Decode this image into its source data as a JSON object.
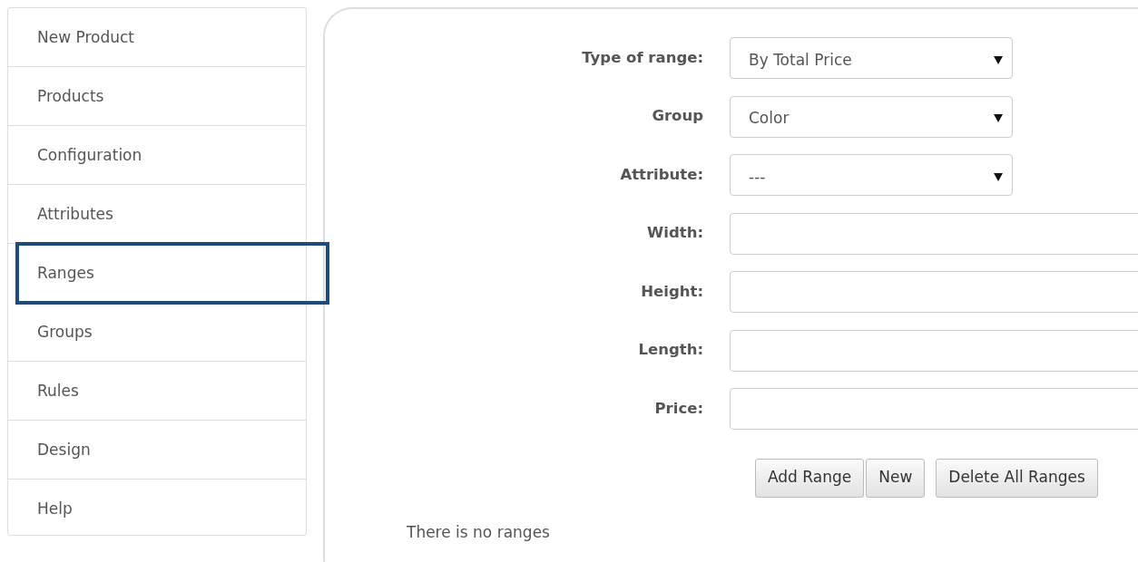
{
  "sidebar": {
    "items": [
      {
        "label": "New Product",
        "selected": false
      },
      {
        "label": "Products",
        "selected": false
      },
      {
        "label": "Configuration",
        "selected": false
      },
      {
        "label": "Attributes",
        "selected": false
      },
      {
        "label": "Ranges",
        "selected": true
      },
      {
        "label": "Groups",
        "selected": false
      },
      {
        "label": "Rules",
        "selected": false
      },
      {
        "label": "Design",
        "selected": false
      },
      {
        "label": "Help",
        "selected": false
      }
    ]
  },
  "form": {
    "fields": [
      {
        "kind": "select",
        "label": "Type of range:",
        "value": "By Total Price"
      },
      {
        "kind": "select",
        "label": "Group",
        "value": "Color"
      },
      {
        "kind": "select",
        "label": "Attribute:",
        "value": "---"
      },
      {
        "kind": "text",
        "label": "Width:"
      },
      {
        "kind": "text",
        "label": "Height:"
      },
      {
        "kind": "text",
        "label": "Length:"
      },
      {
        "kind": "text",
        "label": "Price:"
      }
    ],
    "buttons": [
      {
        "label": "Add Range",
        "kind": "attached"
      },
      {
        "label": "New",
        "kind": "attached"
      },
      {
        "label": "Delete All Ranges",
        "kind": "separate"
      }
    ]
  },
  "message": "There is no ranges"
}
